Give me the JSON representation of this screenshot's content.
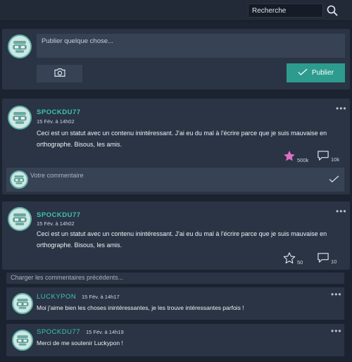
{
  "search": {
    "placeholder": "Recherche"
  },
  "composer": {
    "placeholder": "Publier quelque chose...",
    "publish_label": "Publier"
  },
  "posts": [
    {
      "author": "SPOCKDU77",
      "date": "15 Fév. à 14h02",
      "text": "Ceci est un statut avec un contenu inintéressant. J'ai eu du mal à l'écrire parce que je suis mauvaise en orthographe. Bisous, les amis.",
      "likes": "500k",
      "comments": "10k",
      "liked": true,
      "comment_placeholder": "Votre commentaire"
    },
    {
      "author": "SPOCKDU77",
      "date": "15 Fév. à 14h02",
      "text": "Ceci est un statut avec un contenu inintéressant. J'ai eu du mal à l'écrire parce que je suis mauvaise en orthographe. Bisous, les amis.",
      "likes": "50",
      "comments": "10",
      "liked": false,
      "load_more_label": "Charger les commentaires précédents...",
      "comments_list": [
        {
          "author": "LUCKYPON",
          "date": "15 Fév. à 14h17",
          "text": "Moi j'aime bien les choses inintéressantes, je les trouve intéressantes parfois !"
        },
        {
          "author": "SPOCKDU77",
          "date": "15 Fév. à 14h19",
          "text": "Merci de me soutenir Luckypon !"
        }
      ]
    }
  ],
  "colors": {
    "background": "#1c2330",
    "card": "#2a3444",
    "accent": "#2d9c8e",
    "author": "#3ec4b2",
    "like_active": "#e06fc9"
  },
  "icons": {
    "search": "search-icon",
    "camera": "camera-icon",
    "check": "check-icon",
    "star": "star-icon",
    "comment": "comment-icon",
    "more": "more-icon"
  }
}
